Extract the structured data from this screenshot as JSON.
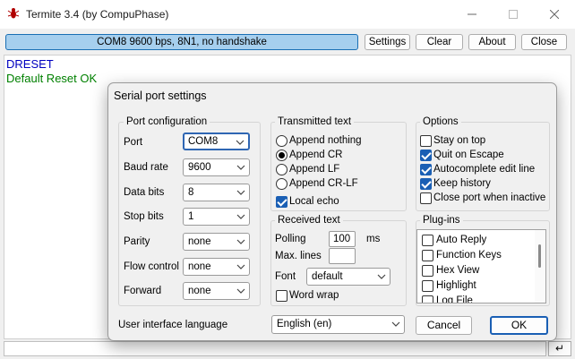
{
  "window": {
    "title": "Termite 3.4 (by CompuPhase)",
    "caption_buttons": [
      "minimize-icon",
      "maximize-icon",
      "close-icon"
    ]
  },
  "toolbar": {
    "status": "COM8 9600 bps, 8N1, no handshake",
    "buttons": [
      "Settings",
      "Clear",
      "About",
      "Close"
    ]
  },
  "terminal": {
    "lines": [
      {
        "text": "DRESET",
        "color": "#0000c0"
      },
      {
        "text": "Default Reset OK",
        "color": "#008000"
      }
    ],
    "enter_icon": "enter-icon",
    "enter_glyph": "↵"
  },
  "dialog": {
    "title": "Serial port settings",
    "port_config": {
      "title": "Port configuration",
      "rows": [
        {
          "label": "Port",
          "value": "COM8"
        },
        {
          "label": "Baud rate",
          "value": "9600"
        },
        {
          "label": "Data bits",
          "value": "8"
        },
        {
          "label": "Stop bits",
          "value": "1"
        },
        {
          "label": "Parity",
          "value": "none"
        },
        {
          "label": "Flow control",
          "value": "none"
        },
        {
          "label": "Forward",
          "value": "none"
        }
      ]
    },
    "transmitted": {
      "title": "Transmitted text",
      "options": [
        {
          "label": "Append nothing",
          "selected": false
        },
        {
          "label": "Append CR",
          "selected": true
        },
        {
          "label": "Append LF",
          "selected": false
        },
        {
          "label": "Append CR-LF",
          "selected": false
        }
      ],
      "local_echo": {
        "label": "Local echo",
        "checked": true
      }
    },
    "received": {
      "title": "Received text",
      "polling_label": "Polling",
      "polling_value": "100",
      "polling_unit": "ms",
      "max_lines_label": "Max. lines",
      "max_lines_value": "",
      "font_label": "Font",
      "font_value": "default",
      "word_wrap": {
        "label": "Word wrap",
        "checked": false
      }
    },
    "options": {
      "title": "Options",
      "items": [
        {
          "label": "Stay on top",
          "checked": false
        },
        {
          "label": "Quit on Escape",
          "checked": true
        },
        {
          "label": "Autocomplete edit line",
          "checked": true
        },
        {
          "label": "Keep history",
          "checked": true
        },
        {
          "label": "Close port when inactive",
          "checked": false
        }
      ]
    },
    "plugins": {
      "title": "Plug-ins",
      "items": [
        {
          "label": "Auto Reply",
          "checked": false
        },
        {
          "label": "Function Keys",
          "checked": false
        },
        {
          "label": "Hex View",
          "checked": false
        },
        {
          "label": "Highlight",
          "checked": false
        },
        {
          "label": "Log File",
          "checked": false
        }
      ]
    },
    "ui_language_label": "User interface language",
    "ui_language_value": "English (en)",
    "cancel": "Cancel",
    "ok": "OK"
  },
  "colors": {
    "accent": "#1a5fb4",
    "status_bg": "#a6cfee"
  }
}
